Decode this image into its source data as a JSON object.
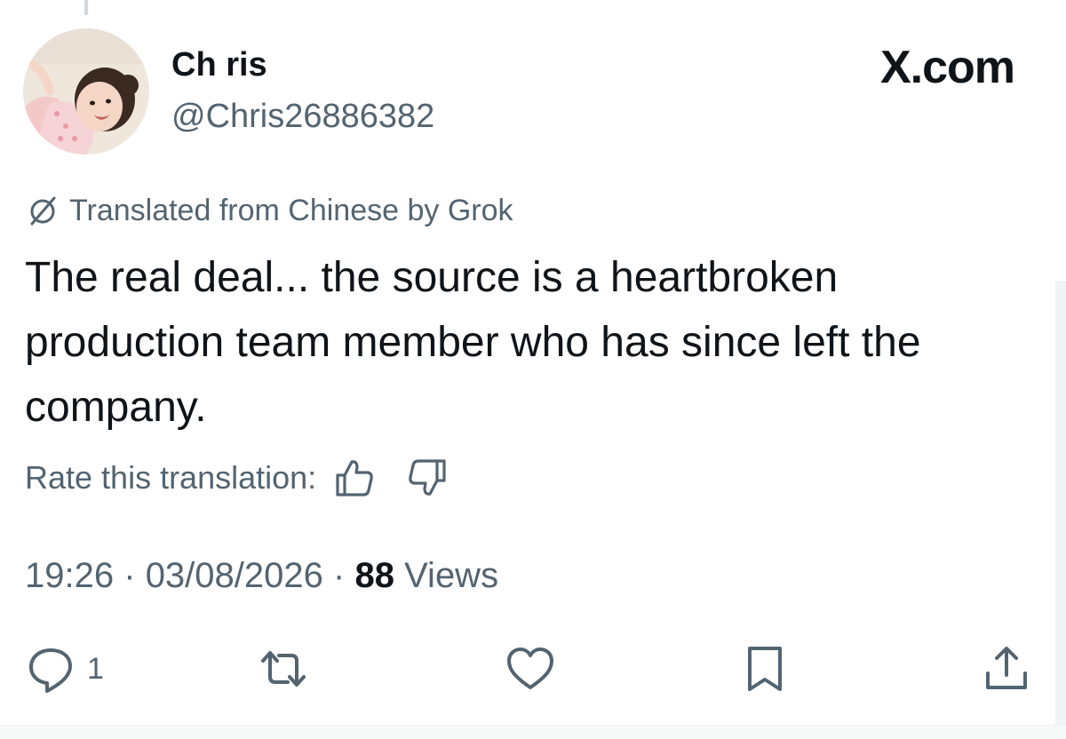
{
  "author": {
    "display_name": "Ch ris",
    "handle": "@Chris26886382"
  },
  "brand": "X.com",
  "translation": {
    "notice": "Translated from Chinese by Grok",
    "rate_label": "Rate this translation:"
  },
  "tweet": {
    "text": "The real deal... the source is a heartbroken production team member who has since left the company."
  },
  "meta": {
    "time": "19:26",
    "date": "03/08/2026",
    "separator": "·",
    "views_count": "88",
    "views_label": "Views"
  },
  "actions": {
    "reply_count": "1"
  },
  "colors": {
    "text_primary": "#0f1419",
    "text_secondary": "#536471"
  }
}
